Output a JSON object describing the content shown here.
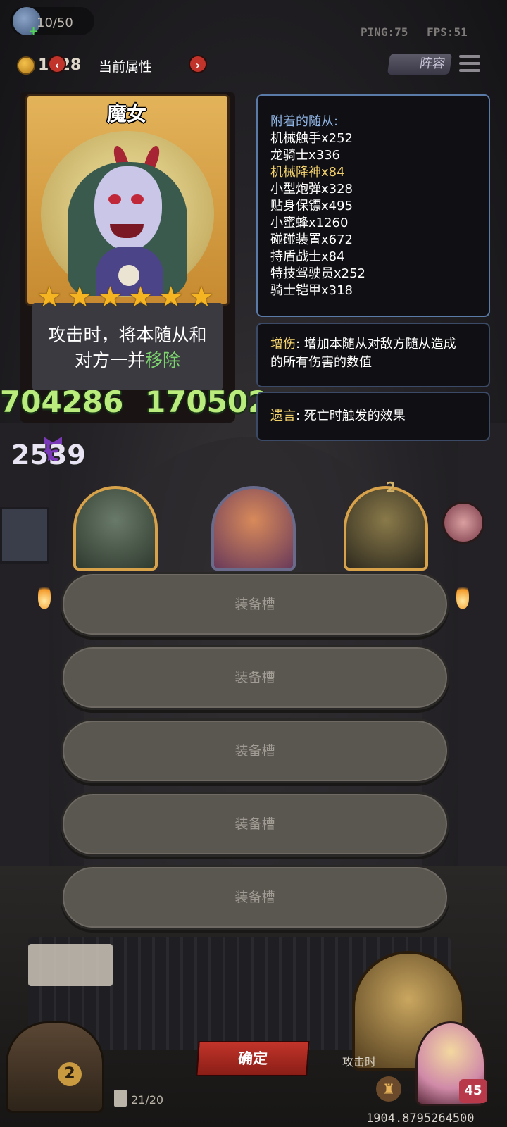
{
  "topbar": {
    "slots": "10/50",
    "ping": "PING:75",
    "fps": "FPS:51",
    "gold": "1128",
    "title": "当前属性",
    "prev": "‹",
    "next": "›",
    "lineup": "阵容"
  },
  "hero": {
    "name": "魔女",
    "stars": [
      "★",
      "★",
      "★",
      "★",
      "★",
      "★"
    ],
    "desc_line1": "攻击时，将本随从和",
    "desc_line2_pre": "对方一并",
    "desc_line2_hl": "移除",
    "attack": "704286",
    "health": "170502",
    "shield": "2539"
  },
  "attached": {
    "header": "附着的随从:",
    "items": [
      {
        "text": "机械触手x252",
        "highlight": false
      },
      {
        "text": "龙骑士x336",
        "highlight": false
      },
      {
        "text": "机械降神x84",
        "highlight": true
      },
      {
        "text": "小型炮弹x328",
        "highlight": false
      },
      {
        "text": "贴身保镖x495",
        "highlight": false
      },
      {
        "text": "小蜜蜂x1260",
        "highlight": false
      },
      {
        "text": "碰碰装置x672",
        "highlight": false
      },
      {
        "text": "持盾战士x84",
        "highlight": false
      },
      {
        "text": "特技驾驶员x252",
        "highlight": false
      },
      {
        "text": "骑士铠甲x318",
        "highlight": false
      }
    ]
  },
  "keywords": {
    "damage_kw": "增伤",
    "damage_line1": ": 增加本随从对敌方随从造成",
    "damage_line2": "的所有伤害的数值",
    "last_kw": "遗言",
    "last_text": ": 死亡时触发的效果"
  },
  "board": {
    "level": "2"
  },
  "equipment": {
    "slots": [
      "装备槽",
      "装备槽",
      "装备槽",
      "装备槽",
      "装备槽"
    ]
  },
  "bottom": {
    "confirm": "确定",
    "deck_count": "21/20",
    "chest_count": "2",
    "hero_text": "攻击时",
    "health_badge": "45",
    "coords": "1904.8795264500"
  },
  "colors": {
    "accent_green": "#b9ec7c",
    "keyword_gold": "#f1cf6a",
    "confirm_red": "#c1342a",
    "star_gold": "#f5b522"
  }
}
